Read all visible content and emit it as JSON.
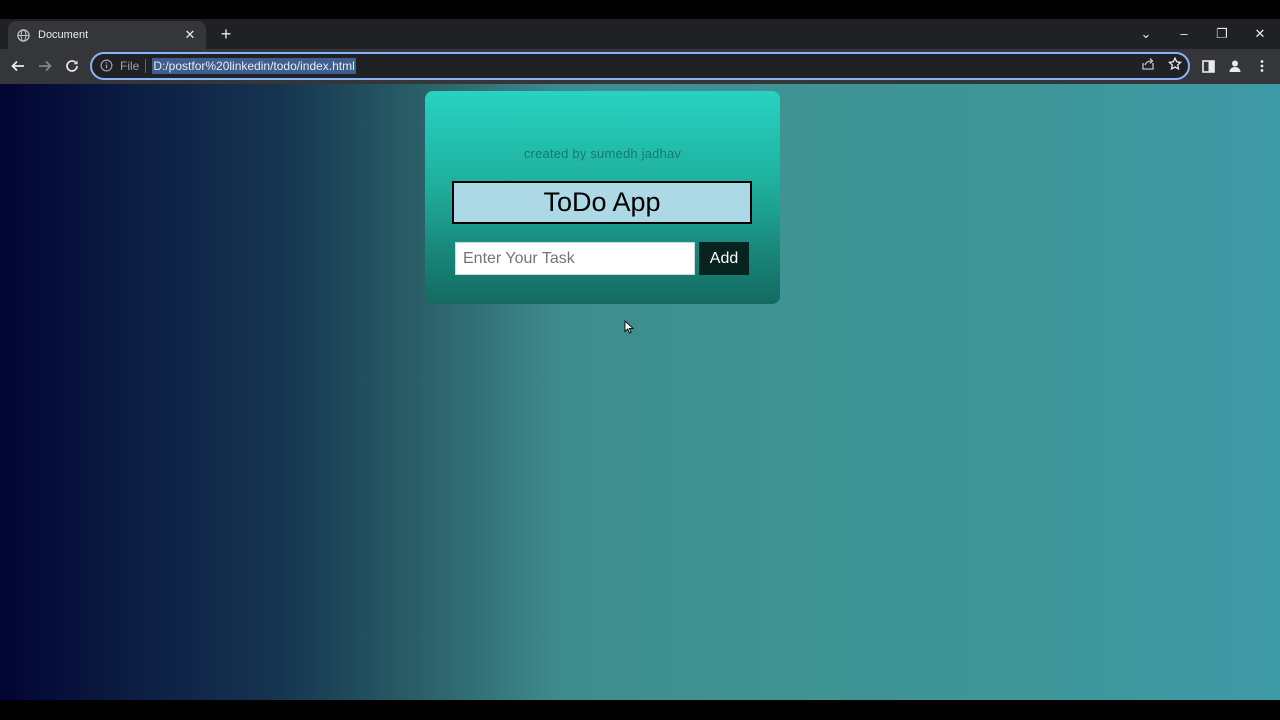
{
  "browser": {
    "tab_title": "Document",
    "tab_close": "✕",
    "new_tab": "+",
    "address_prefix": "File",
    "url": "D:/postfor%20linkedin/todo/index.html",
    "window_controls": {
      "minimize": "–",
      "restore": "❐",
      "close": "✕",
      "tab_search": "⌄"
    }
  },
  "app": {
    "credit": "created by sumedh jadhav",
    "title": "ToDo App",
    "input_placeholder": "Enter Your Task",
    "input_value": "",
    "add_label": "Add"
  },
  "colors": {
    "card_top": "#27d3c2",
    "card_bottom": "#146a60",
    "heading_bg": "#add8e6",
    "add_button_bg": "#06231f",
    "omnibox_focus": "#8ab4f8"
  }
}
